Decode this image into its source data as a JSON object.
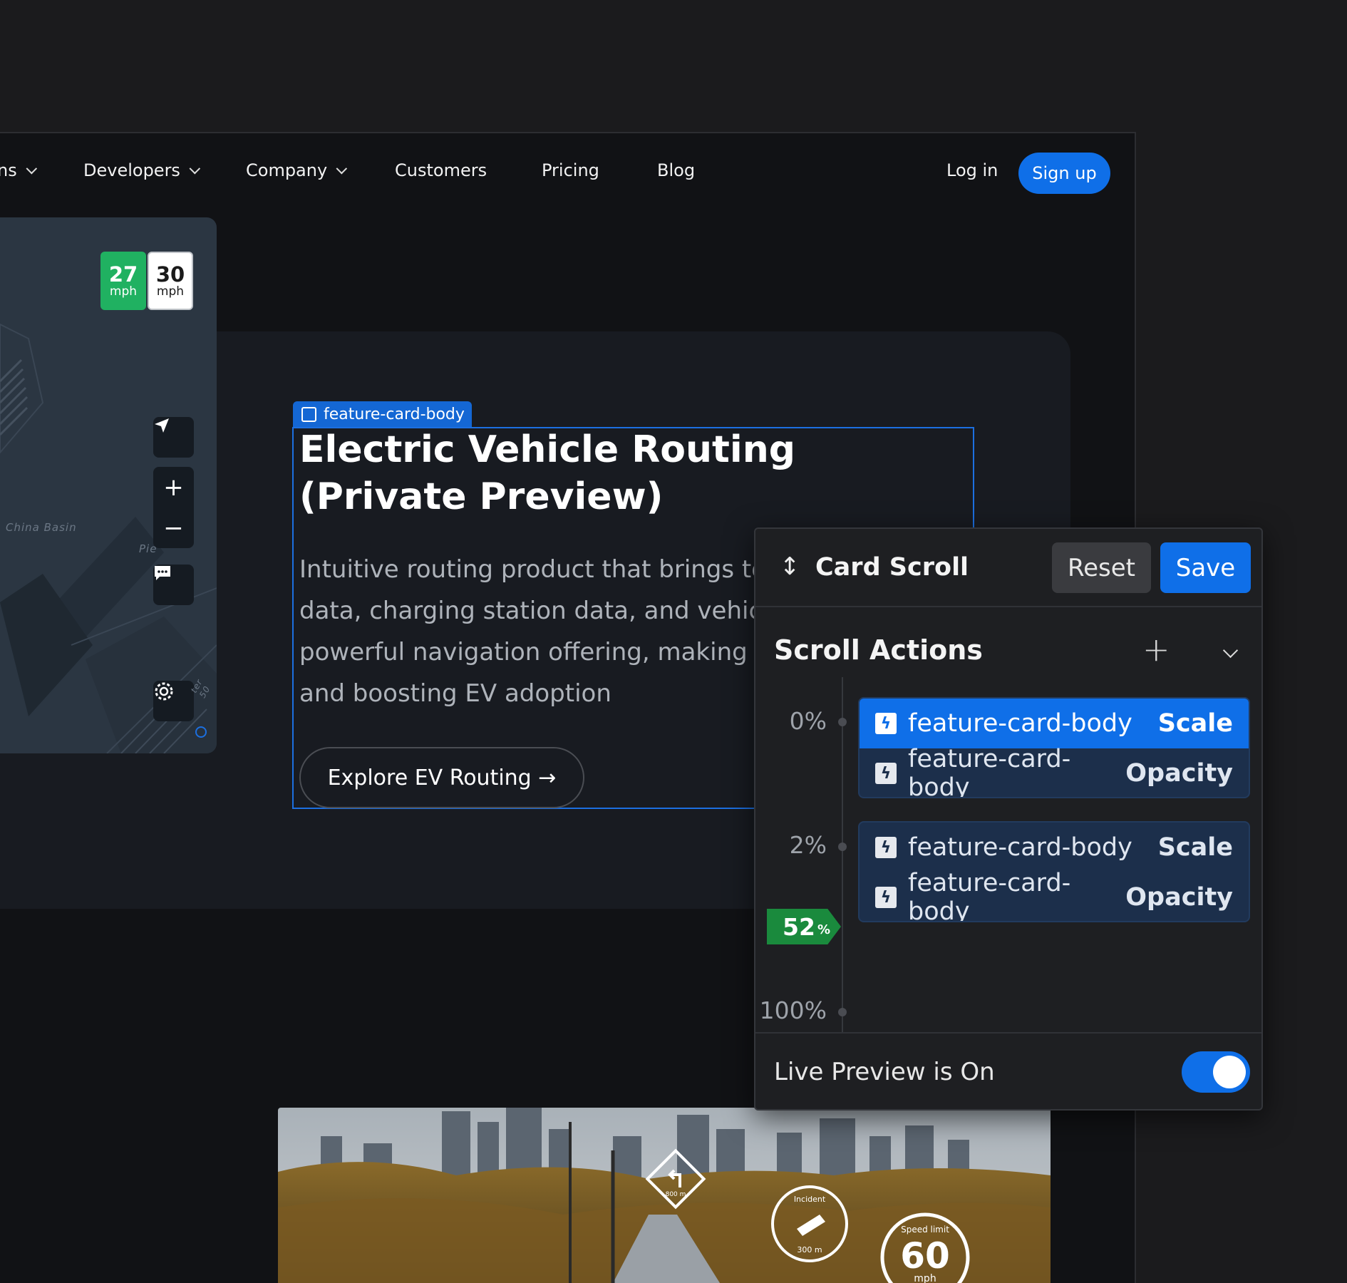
{
  "nav": {
    "items": [
      {
        "label": "ns",
        "dropdown": true
      },
      {
        "label": "Developers",
        "dropdown": true
      },
      {
        "label": "Company",
        "dropdown": true
      },
      {
        "label": "Customers",
        "dropdown": false
      },
      {
        "label": "Pricing",
        "dropdown": false
      },
      {
        "label": "Blog",
        "dropdown": false
      }
    ],
    "login": "Log in",
    "signup": "Sign up"
  },
  "map": {
    "current_speed": "27",
    "current_unit": "mph",
    "limit_speed": "30",
    "limit_unit": "mph",
    "label_basin": "China Basin",
    "label_pier": "Pie",
    "label_street": "ter 50"
  },
  "feature": {
    "tag": "feature-card-body",
    "title_line1": "Electric Vehicle Routing",
    "title_line2": "(Private Preview)",
    "desc_lines": [
      "Intuitive routing product that brings tog",
      "data, charging station data, and vehicle",
      "powerful navigation offering, making EV",
      "and boosting EV adoption"
    ],
    "cta": "Explore EV Routing →"
  },
  "photo": {
    "sign_distance": "800 m",
    "incident_label": "Incident",
    "incident_distance": "300 m",
    "speed_limit_label": "Speed limit",
    "speed_limit_value": "60",
    "speed_limit_unit": "mph"
  },
  "panel": {
    "title": "Card Scroll",
    "reset": "Reset",
    "save": "Save",
    "section_title": "Scroll Actions",
    "marks": [
      "0%",
      "2%",
      "100%"
    ],
    "current_position": "52",
    "current_unit": "%",
    "groups": [
      {
        "rows": [
          {
            "target": "feature-card-body",
            "property": "Scale",
            "active": true
          },
          {
            "target": "feature-card-body",
            "property": "Opacity",
            "active": false
          }
        ]
      },
      {
        "rows": [
          {
            "target": "feature-card-body",
            "property": "Scale",
            "active": false
          },
          {
            "target": "feature-card-body",
            "property": "Opacity",
            "active": false
          }
        ]
      }
    ],
    "live_preview": "Live Preview is On",
    "live_preview_on": true
  },
  "colors": {
    "accent": "#0f6fe8",
    "speed_green": "#20b161",
    "marker_green": "#1a8a3d"
  }
}
